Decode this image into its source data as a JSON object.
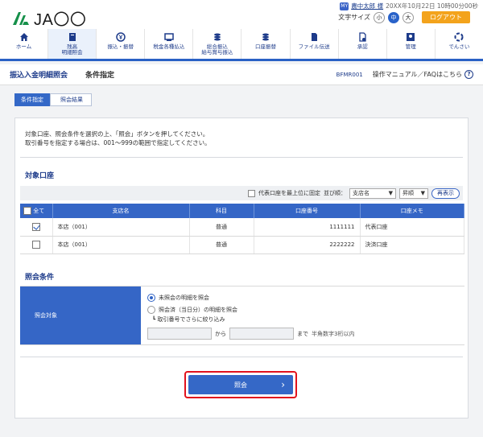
{
  "header": {
    "logo": "JA〇〇",
    "user_icon": "MY",
    "user_name": "農中太郎 様",
    "datetime": "20XX年10月22日 10時00分00秒",
    "font_size_label": "文字サイズ",
    "font_sizes": [
      "小",
      "中",
      "大"
    ],
    "logout": "ログアウト"
  },
  "nav": [
    {
      "label": "ホーム",
      "icon": "home-icon"
    },
    {
      "label": "残高\n明細照会",
      "icon": "passbook-icon"
    },
    {
      "label": "振込・振替",
      "icon": "yen-transfer-icon"
    },
    {
      "label": "税金各種払込",
      "icon": "tax-icon"
    },
    {
      "label": "総合振込\n給与賞与振込",
      "icon": "bulk-transfer-icon"
    },
    {
      "label": "口座振替",
      "icon": "account-transfer-icon"
    },
    {
      "label": "ファイル伝送",
      "icon": "file-transfer-icon"
    },
    {
      "label": "承認",
      "icon": "approval-icon"
    },
    {
      "label": "管理",
      "icon": "admin-icon"
    },
    {
      "label": "でんさい",
      "icon": "densai-icon"
    }
  ],
  "titlebar": {
    "main": "振込入金明細照会",
    "sub": "条件指定",
    "screen_id": "BFMR001",
    "manual": "操作マニュアル／FAQはこちら"
  },
  "steps": [
    "条件指定",
    "照会結果"
  ],
  "intro": {
    "line1": "対象口座、照会条件を選択の上、「照会」ボタンを押してください。",
    "line2": "取引番号を指定する場合は、001～999の範囲で指定してください。"
  },
  "accounts": {
    "title": "対象口座",
    "rep_top_label": "代表口座を最上位に固定",
    "sort_label": "並び順：",
    "sort_key": "支店名",
    "sort_order": "昇順",
    "redisplay": "再表示",
    "headers": [
      "全て",
      "支店名",
      "科目",
      "口座番号",
      "口座メモ"
    ],
    "rows": [
      {
        "checked": true,
        "branch": "本店（001）",
        "subject": "普通",
        "number": "1111111",
        "memo": "代表口座"
      },
      {
        "checked": false,
        "branch": "本店（001）",
        "subject": "普通",
        "number": "2222222",
        "memo": "決済口座"
      }
    ]
  },
  "conditions": {
    "title": "照会条件",
    "label": "照会対象",
    "opt1": "未照会の明細を照会",
    "opt2": "照会済（当日分）の明細を照会",
    "narrow": "取引番号でさらに絞り込み",
    "from": "から",
    "to": "まで",
    "note": "半角数字3桁以内"
  },
  "submit": {
    "label": "照会"
  },
  "colors": {
    "primary": "#3566c6",
    "logout": "#f3a31c",
    "highlight": "#e2121d"
  }
}
